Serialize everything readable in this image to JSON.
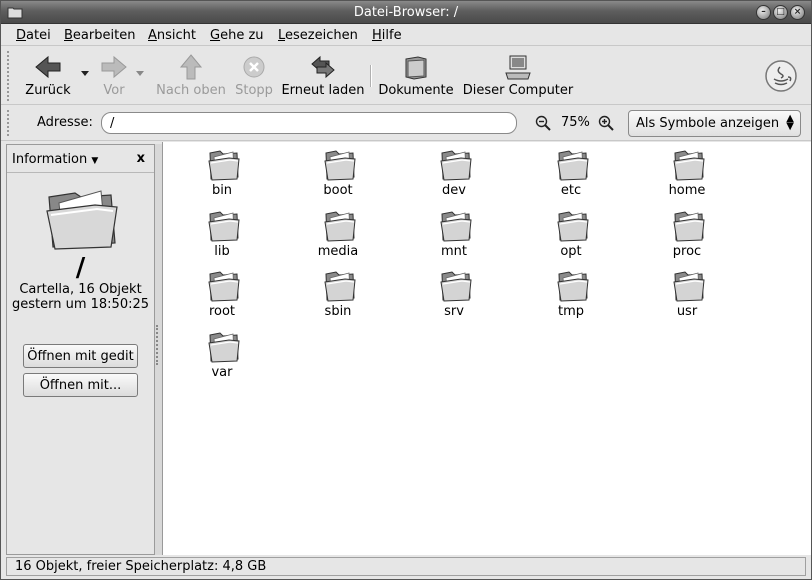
{
  "window": {
    "title": "Datei-Browser: /"
  },
  "menubar": {
    "items": [
      {
        "u": "D",
        "rest": "atei"
      },
      {
        "u": "B",
        "rest": "earbeiten"
      },
      {
        "u": "A",
        "rest": "nsicht"
      },
      {
        "u": "G",
        "rest": "ehe zu"
      },
      {
        "u": "L",
        "rest": "esezeichen"
      },
      {
        "u": "H",
        "rest": "ilfe"
      }
    ]
  },
  "toolbar": {
    "back": "Zurück",
    "forward": "Vor",
    "up": "Nach oben",
    "stop": "Stopp",
    "reload": "Erneut laden",
    "documents": "Dokumente",
    "computer": "Dieser Computer"
  },
  "location": {
    "label": "Adresse:",
    "value": "/",
    "zoom": "75%",
    "view_mode": "Als Symbole anzeigen"
  },
  "side": {
    "title": "Information",
    "close": "x",
    "folder_name": "/",
    "info_line1": "Cartella, 16 Objekt",
    "info_line2": "gestern um 18:50:25",
    "open_gedit": "Öffnen mit gedit",
    "open_with": "Öffnen mit..."
  },
  "files": [
    "bin",
    "boot",
    "dev",
    "etc",
    "home",
    "lib",
    "media",
    "mnt",
    "opt",
    "proc",
    "root",
    "sbin",
    "srv",
    "tmp",
    "usr",
    "var"
  ],
  "status": {
    "text": "16 Objekt, freier Speicherplatz: 4,8 GB"
  },
  "colors": {
    "title_bar": "#5e5e5e",
    "window_bg": "#e6e6e6",
    "content_bg": "#ffffff"
  }
}
